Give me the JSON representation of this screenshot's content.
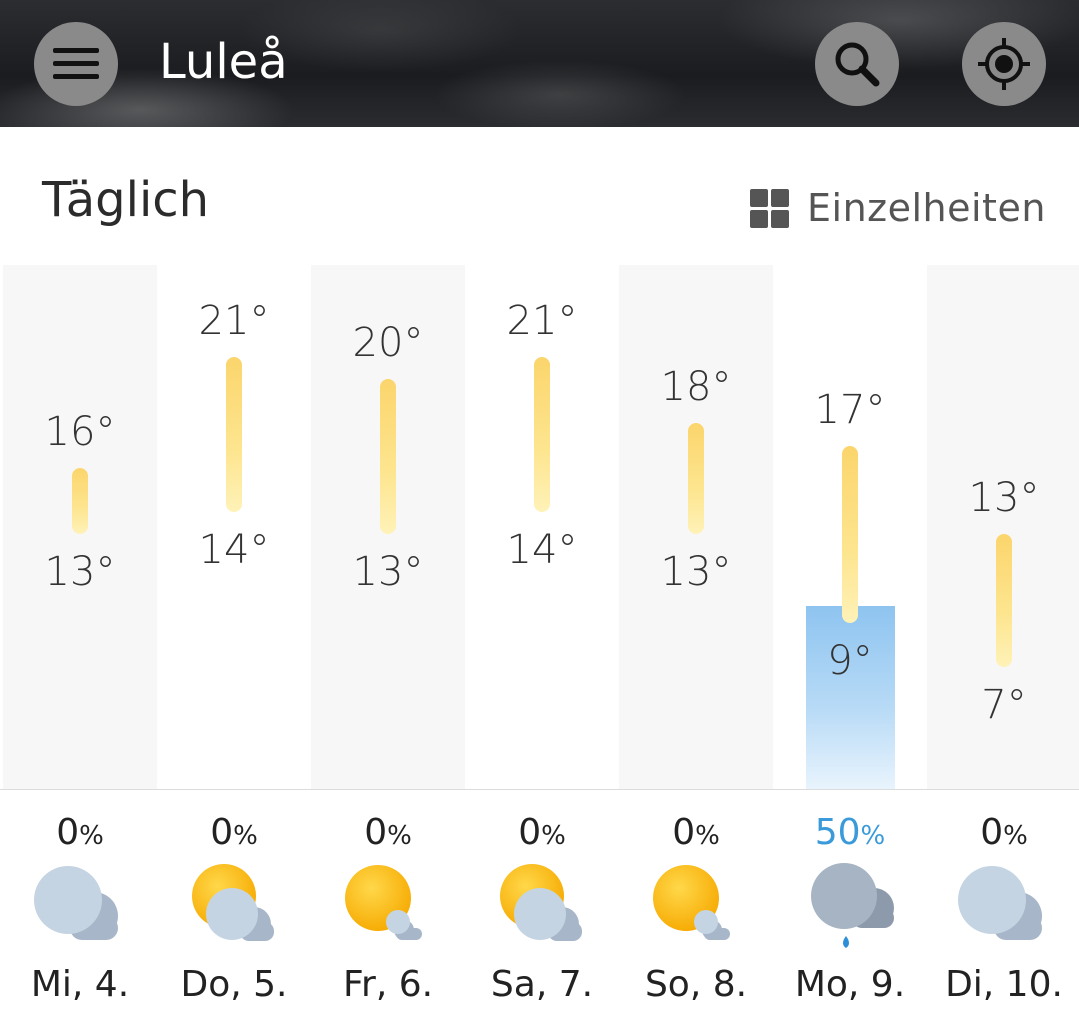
{
  "header": {
    "city": "Luleå",
    "menu_icon": "hamburger-menu-icon",
    "search_icon": "search-icon",
    "location_icon": "current-location-icon"
  },
  "section": {
    "title": "Täglich",
    "details_label": "Einzelheiten",
    "details_icon": "grid-view-icon"
  },
  "colors": {
    "temp_bar_top": "#fbd56c",
    "temp_bar_bottom": "#fff2b8",
    "rain_bar": "#8ec4f0",
    "rain_text": "#3b9ad9",
    "column_bg": "#f7f7f7"
  },
  "chart_data": {
    "type": "bar",
    "categories": [
      "Mi, 4.",
      "Do, 5.",
      "Fr, 6.",
      "Sa, 7.",
      "So, 8.",
      "Mo, 9.",
      "Di, 10."
    ],
    "high": [
      16,
      21,
      20,
      21,
      18,
      17,
      13
    ],
    "low": [
      13,
      14,
      13,
      14,
      13,
      9,
      7
    ],
    "precip_percent": [
      0,
      0,
      0,
      0,
      0,
      50,
      0
    ]
  },
  "days": [
    {
      "label": "Mi, 4.",
      "high": "16°",
      "low": "13°",
      "precip": "0",
      "icon": "cloudy-icon"
    },
    {
      "label": "Do, 5.",
      "high": "21°",
      "low": "14°",
      "precip": "0",
      "icon": "partly-cloudy-icon"
    },
    {
      "label": "Fr, 6.",
      "high": "20°",
      "low": "13°",
      "precip": "0",
      "icon": "mostly-sunny-icon"
    },
    {
      "label": "Sa, 7.",
      "high": "21°",
      "low": "14°",
      "precip": "0",
      "icon": "partly-cloudy-icon"
    },
    {
      "label": "So, 8.",
      "high": "18°",
      "low": "13°",
      "precip": "0",
      "icon": "mostly-sunny-icon"
    },
    {
      "label": "Mo, 9.",
      "high": "17°",
      "low": "9°",
      "precip": "50",
      "icon": "rain-showers-icon"
    },
    {
      "label": "Di, 10.",
      "high": "13°",
      "low": "7°",
      "precip": "0",
      "icon": "cloudy-icon"
    }
  ],
  "percent_sign": "%"
}
